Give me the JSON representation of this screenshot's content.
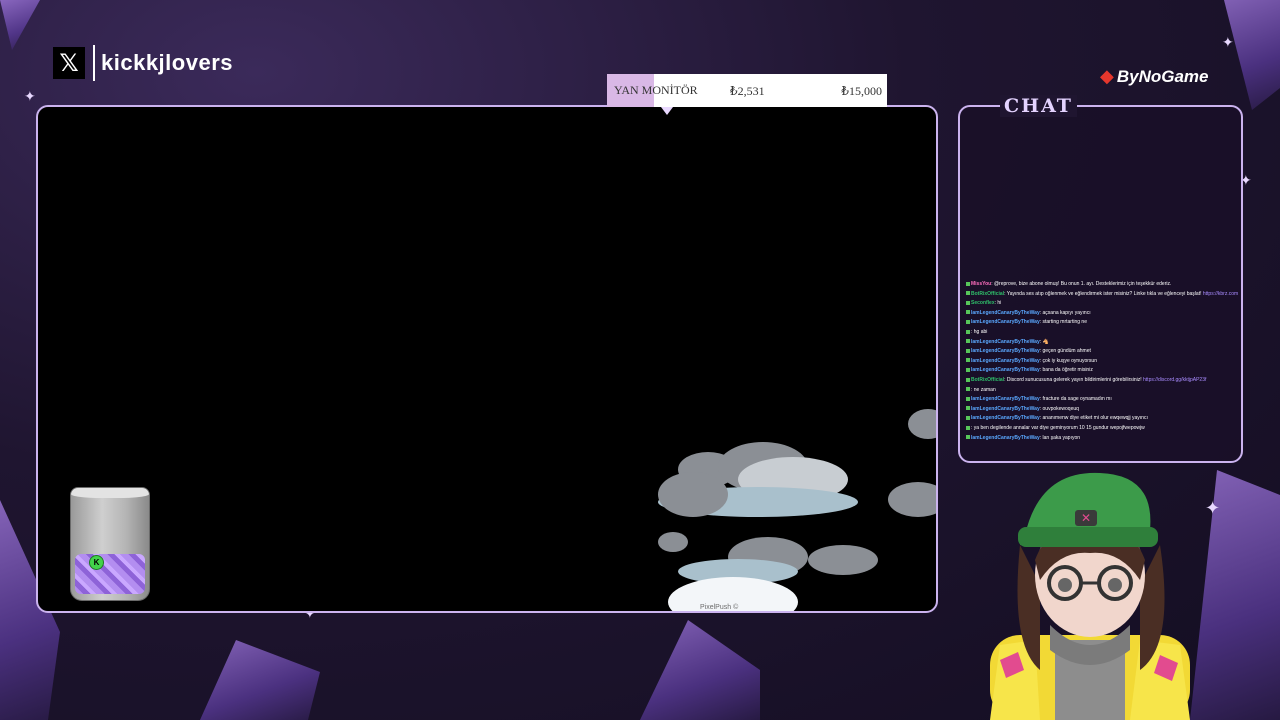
{
  "brand": {
    "platform_icon": "x-logo-icon",
    "handle": "kickkjlovers"
  },
  "sponsor": {
    "name": "ByNoGame",
    "icon": "bynogame-logo-icon"
  },
  "goal": {
    "label": "YAN MONİTÖR",
    "current": "₺2,531",
    "target": "₺15,000",
    "progress": 0.169
  },
  "chat": {
    "title": "CHAT",
    "messages": [
      {
        "user": "MissYou",
        "text": ": @reprove, bize abone olmuş! Bu onun 1. ayı. Desteklerimiz için teşekkür ederiz.",
        "style": "pink"
      },
      {
        "user": "BotRixOfficial",
        "text": ": Yayında ses atıp oğlenmek ve eğlendirmek ister misiniz? Linke tıkla ve eğlenceyi başlat!",
        "link": "https://kbrz.com/ick2lovers",
        "style": "green"
      },
      {
        "user": "Seconflex",
        "text": ": hi",
        "style": "green"
      },
      {
        "user": "IamLegendCanaryByTheWay",
        "text": ": açsana kapıyı yayıncı",
        "style": "blue"
      },
      {
        "user": "IamLegendCanaryByTheWay",
        "text": ": starting mrtarting ne",
        "style": "blue"
      },
      {
        "user": "",
        "text": ": hg abi",
        "style": "blue"
      },
      {
        "user": "IamLegendCanaryByTheWay",
        "text": ": 🐴",
        "style": "blue"
      },
      {
        "user": "IamLegendCanaryByTheWay",
        "text": ": geçen gündüm ahmet",
        "style": "blue"
      },
      {
        "user": "IamLegendCanaryByTheWay",
        "text": ": çok iy kuşye oynuyorsun",
        "style": "blue"
      },
      {
        "user": "IamLegendCanaryByTheWay",
        "text": ": bana da öğretir misiniz",
        "style": "blue"
      },
      {
        "user": "BotRixOfficial",
        "text": ": Discord sunucusuna gelerek yayın bildirimlerini görebilirsiniz!",
        "link": "https://discord.gg/kktjpAP23f",
        "style": "green"
      },
      {
        "user": "",
        "text": ": ne zaman",
        "style": "blue"
      },
      {
        "user": "IamLegendCanaryByTheWay",
        "text": ": fracture da sage oynamadın mı",
        "style": "blue"
      },
      {
        "user": "IamLegendCanaryByTheWay",
        "text": ": ouvpokewoqeuq",
        "style": "blue"
      },
      {
        "user": "IamLegendCanaryByTheWay",
        "text": ": ananımenw diye etiket mi olur ewqewqjj yayıncı",
        "style": "blue"
      },
      {
        "user": "",
        "text": ": ya ben degilende annalar var diye geminyorum 10 15 gundur wepojfwepowjw",
        "style": "blue"
      },
      {
        "user": "IamLegendCanaryByTheWay",
        "text": ": lan şaka yapıyon",
        "style": "blue"
      }
    ]
  },
  "game": {
    "credit": "PixelPush ©"
  },
  "tip_jar": {
    "coin_label": "K"
  },
  "colors": {
    "frame": "#cbb3ef",
    "background": "#1f1530",
    "accent": "#9d6de0"
  }
}
